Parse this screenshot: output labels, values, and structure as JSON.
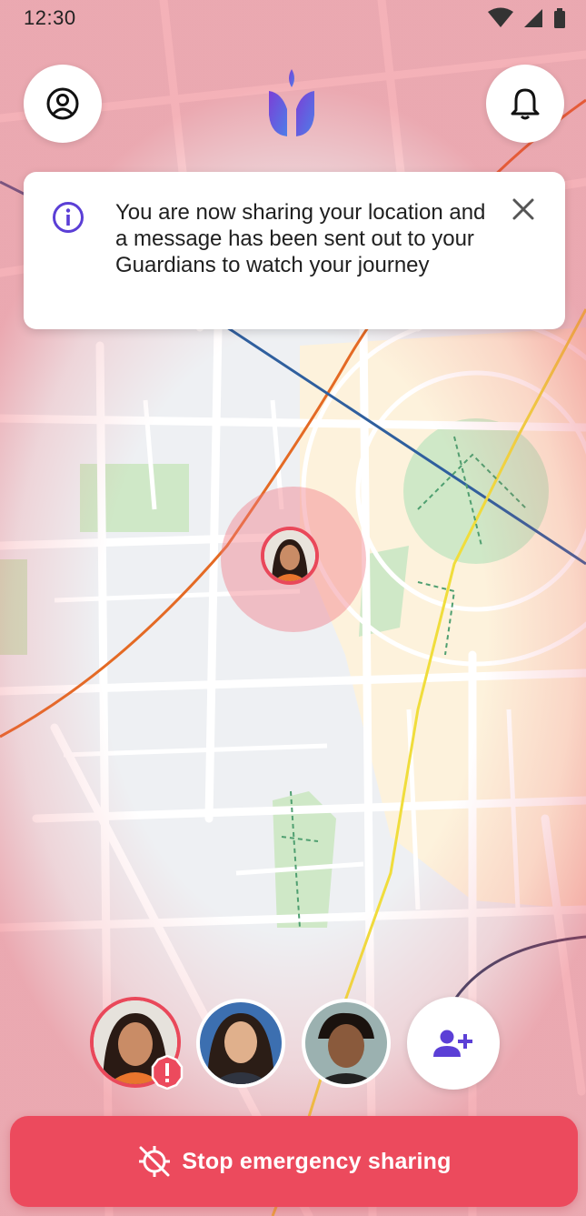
{
  "status_bar": {
    "time": "12:30",
    "icons": [
      "wifi-icon",
      "cell-signal-icon",
      "battery-icon"
    ]
  },
  "header": {
    "profile_icon": "account-circle-icon",
    "logo": "tulip-logo",
    "notifications_icon": "bell-icon"
  },
  "banner": {
    "icon": "info-icon",
    "message": "You are now sharing your location and a message has been sent out to your Guardians to watch your journey",
    "close_icon": "close-icon"
  },
  "map": {
    "user_marker": "user-location-marker"
  },
  "guardians": [
    {
      "name_icon": "avatar-user-alert",
      "alert": true
    },
    {
      "name_icon": "avatar-guardian-1",
      "alert": false
    },
    {
      "name_icon": "avatar-guardian-2",
      "alert": false
    }
  ],
  "add_guardian_icon": "person-add-icon",
  "primary_action": {
    "label": "Stop emergency sharing",
    "icon": "location-off-icon"
  },
  "colors": {
    "accent_red": "#ec4a5d",
    "brand_purple": "#5b3fd6",
    "brand_blue": "#4d7ee8",
    "park_green": "#cde9c6",
    "road_yellow": "#f0dd3c",
    "road_orange": "#e46a24",
    "road_blue": "#2f5f9e"
  }
}
